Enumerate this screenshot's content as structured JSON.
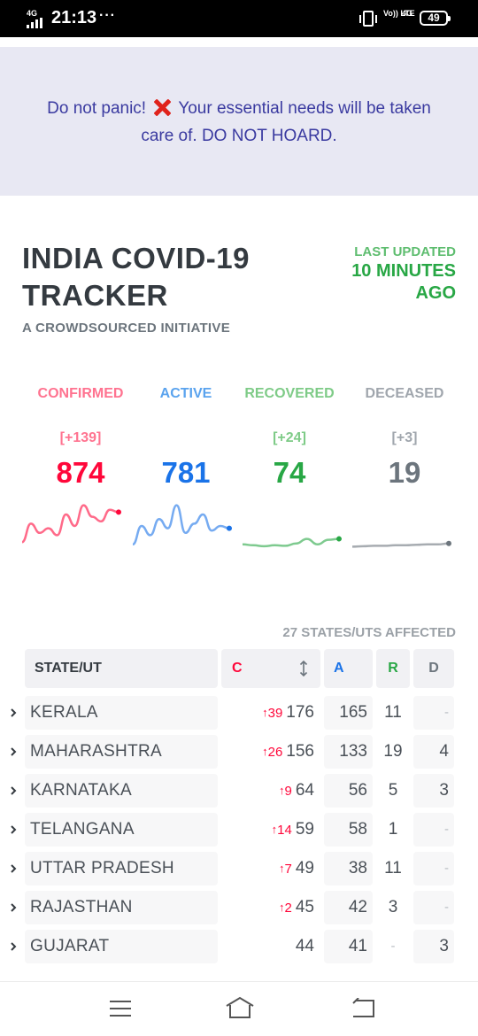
{
  "status_bar": {
    "network": "4G",
    "time": "21:13",
    "dots": "···",
    "volte": "Vo)) LTE",
    "net2": "4G",
    "battery": "49"
  },
  "banner": {
    "text_before": "Do not panic!",
    "icon": "cross-mark-icon",
    "text_after": "Your essential needs will be taken care of. DO NOT HOARD."
  },
  "header": {
    "title": "INDIA COVID-19 TRACKER",
    "subtitle": "A CROWDSOURCED INITIATIVE",
    "last_updated_label": "LAST UPDATED",
    "last_updated_value": "10 MINUTES AGO"
  },
  "stats": {
    "confirmed": {
      "label": "CONFIRMED",
      "delta": "[+139]",
      "value": "874",
      "color": "#ff073a",
      "trend": [
        0.15,
        0.55,
        0.35,
        0.45,
        0.3,
        0.75,
        0.5,
        0.95,
        0.7,
        0.6,
        0.85,
        0.8
      ]
    },
    "active": {
      "label": "ACTIVE",
      "delta": "",
      "value": "781",
      "color": "#1a73e8",
      "trend": [
        0.1,
        0.5,
        0.3,
        0.65,
        0.45,
        0.95,
        0.35,
        0.55,
        0.75,
        0.4,
        0.5,
        0.45
      ]
    },
    "recovered": {
      "label": "RECOVERED",
      "delta": "[+24]",
      "value": "74",
      "color": "#28a745",
      "trend": [
        0.1,
        0.08,
        0.06,
        0.08,
        0.07,
        0.12,
        0.22,
        0.1,
        0.2,
        0.22
      ]
    },
    "deceased": {
      "label": "DECEASED",
      "delta": "[+3]",
      "value": "19",
      "color": "#6c757d",
      "trend": [
        0.05,
        0.06,
        0.07,
        0.07,
        0.08,
        0.08,
        0.09,
        0.1,
        0.1,
        0.12
      ]
    }
  },
  "table": {
    "affected": "27 STATES/UTS AFFECTED",
    "headers": {
      "state": "STATE/UT",
      "confirmed": "C",
      "active": "A",
      "recovered": "R",
      "deceased": "D"
    },
    "rows": [
      {
        "state": "KERALA",
        "delta": "39",
        "confirmed": "176",
        "active": "165",
        "recovered": "11",
        "deceased": "-"
      },
      {
        "state": "MAHARASHTRA",
        "delta": "26",
        "confirmed": "156",
        "active": "133",
        "recovered": "19",
        "deceased": "4"
      },
      {
        "state": "KARNATAKA",
        "delta": "9",
        "confirmed": "64",
        "active": "56",
        "recovered": "5",
        "deceased": "3"
      },
      {
        "state": "TELANGANA",
        "delta": "14",
        "confirmed": "59",
        "active": "58",
        "recovered": "1",
        "deceased": "-"
      },
      {
        "state": "UTTAR PRADESH",
        "delta": "7",
        "confirmed": "49",
        "active": "38",
        "recovered": "11",
        "deceased": "-"
      },
      {
        "state": "RAJASTHAN",
        "delta": "2",
        "confirmed": "45",
        "active": "42",
        "recovered": "3",
        "deceased": "-"
      },
      {
        "state": "GUJARAT",
        "delta": "",
        "confirmed": "44",
        "active": "41",
        "recovered": "-",
        "deceased": "3"
      }
    ]
  }
}
